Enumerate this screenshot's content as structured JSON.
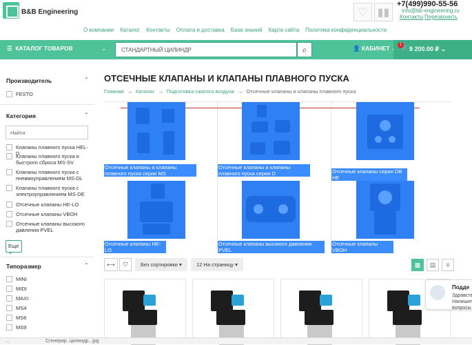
{
  "header": {
    "brand": "B&B Engineering",
    "phone": "+7(499)990-55-56",
    "email": "info@bb-engineering.ru",
    "contacts_link": "Контакты",
    "callback_link": "Перезвонить",
    "nav": [
      "О компании",
      "Каталог",
      "Контакты",
      "Оплата и доставка",
      "База знаний",
      "Карта сайта",
      "Политика конфиденциальности"
    ]
  },
  "toolbar": {
    "catalog_label": "КАТАЛОГ ТОВАРОВ",
    "search_value": "СТАНДАРТНЫЙ ЦИЛИНДР",
    "cabinet_label": "КАБИНЕТ",
    "cart_count": "1",
    "cart_total": "9 200.00 ₽"
  },
  "sidebar": {
    "manufacturer_title": "Производитель",
    "manufacturers": [
      "FESTO"
    ],
    "category_title": "Категория",
    "find_placeholder": "Найти",
    "categories": [
      "Клапаны плавного пуска HEL-D",
      "Клапаны плавного пуска и быстрого сброса MS-SV",
      "Клапаны плавного пуска с пневмоуправлением MS-DL",
      "Клапаны плавного пуска с электроуправлением MS-DE",
      "Отсечные клапаны HE-LO",
      "Отсечные клапаны VBOH",
      "Отсечные клапаны высокого давления PVEL"
    ],
    "more_label": "Еще",
    "size_title": "Типоразмер",
    "sizes": [
      "MINI",
      "MIDI",
      "MAXI",
      "MS4",
      "MS6",
      "MS9"
    ]
  },
  "main": {
    "title": "ОТСЕЧНЫЕ КЛАПАНЫ И КЛАПАНЫ ПЛАВНОГО ПУСКА",
    "breadcrumb": [
      "Главная",
      "Каталог",
      "Подготовка сжатого воздуха",
      "Отсечные клапаны и клапаны плавного пуска"
    ],
    "subcategories": [
      "Отсечные клапаны и клапаны плавного пуска серии MS",
      "Отсечные клапаны и клапаны плавного пуска серии D",
      "Отсечные клапаны серии DB HE",
      "Отсечные клапаны HE-LO",
      "Отсечные клапаны высокого давления PVEL",
      "Отсечные клапаны VBOH"
    ],
    "sort_label": "Без сортировки",
    "per_page_label": "12 На страницу"
  },
  "chat": {
    "title": "Подде",
    "line1": "Здравств",
    "line2": "Напишит",
    "line3": "вопросы"
  },
  "taskbar": {
    "item1": "...",
    "item2": "Сгенерир. цилиндр...jpg"
  }
}
